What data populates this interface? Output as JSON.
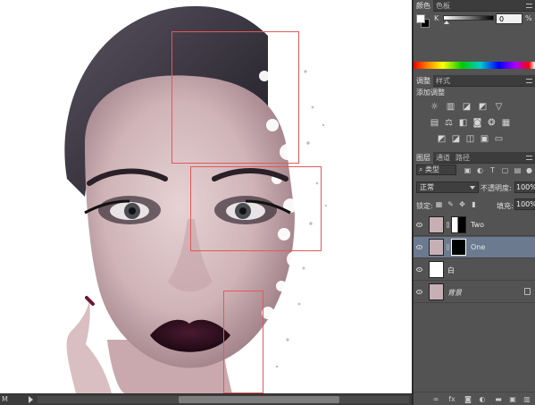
{
  "status": {
    "zoom_text": "M"
  },
  "color_panel": {
    "tabs": [
      "颜色",
      "色板"
    ],
    "channel_label": "K",
    "channel_value": "0",
    "channel_unit": "%",
    "foreground_color": "#ffffff",
    "background_color": "#000000"
  },
  "adjustments_panel": {
    "tabs": [
      "调整",
      "样式"
    ],
    "title": "添加调整",
    "row1_icons": [
      "brightness-icon",
      "levels-icon",
      "curves-icon",
      "exposure-icon",
      "vibrance-icon"
    ],
    "row2_icons": [
      "hue-saturation-icon",
      "color-balance-icon",
      "black-white-icon",
      "photo-filter-icon",
      "channel-mixer-icon",
      "color-lookup-icon"
    ],
    "row3_icons": [
      "invert-icon",
      "posterize-icon",
      "threshold-icon",
      "selective-color-icon",
      "gradient-map-icon"
    ]
  },
  "layers_panel": {
    "tabs": [
      "图层",
      "通道",
      "路径"
    ],
    "filter_kind": "类型",
    "blend_mode": "正常",
    "opacity_label": "不透明度:",
    "opacity_value": "100%",
    "lock_label": "锁定:",
    "fill_label": "填充:",
    "fill_value": "100%",
    "layers": [
      {
        "name": "Two",
        "visible": true,
        "selected": false,
        "has_mask": true
      },
      {
        "name": "One",
        "visible": true,
        "selected": true,
        "has_mask": true
      },
      {
        "name": "白",
        "visible": true,
        "selected": false,
        "has_mask": false
      },
      {
        "name": "背景",
        "visible": true,
        "selected": false,
        "has_mask": false,
        "locked": true
      }
    ],
    "footer_icons": [
      "link-icon",
      "fx-icon",
      "mask-icon",
      "adjustment-icon",
      "folder-icon",
      "new-layer-icon",
      "trash-icon"
    ]
  },
  "colors": {
    "panel_bg": "#535353",
    "tab_bar": "#3c3c3c",
    "selected_layer": "#6b7a8e",
    "selection_outline": "#e05a5a"
  }
}
